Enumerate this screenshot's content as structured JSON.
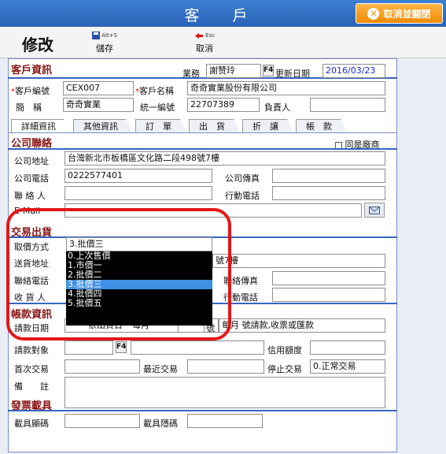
{
  "window": {
    "title": "客 戶",
    "cancel_close": "取消並關閉"
  },
  "toolbar": {
    "mode": "修改",
    "save": {
      "shortcut": "Alt+S",
      "label": "儲存"
    },
    "cancel": {
      "shortcut": "Esc",
      "label": "取消"
    }
  },
  "customer": {
    "section": "客戶資訊",
    "sales_label": "業務",
    "sales_value": "謝赞玲",
    "f4": "F4",
    "updated_label": "更新日期",
    "updated_value": "2016/03/23",
    "code_label": "客戶編號",
    "code_value": "CEX007",
    "name_label": "客戶名稱",
    "name_value": "奇奇實業股份有限公司",
    "abbr_label": "簡　稱",
    "abbr_value": "奇奇實業",
    "taxid_label": "統一編號",
    "taxid_value": "22707389",
    "owner_label": "負責人",
    "owner_value": ""
  },
  "tabs": [
    "詳細資訊",
    "其他資訊",
    "訂　單",
    "出　貨",
    "折　讓",
    "帳　款"
  ],
  "contact": {
    "section": "公司聯絡",
    "same_factory": "同是廠商",
    "address_label": "公司地址",
    "address_value": "台灣新北市板橋區文化路二段498號7樓",
    "phone_label": "公司電話",
    "phone_value": "0222577401",
    "fax_label": "公司傳真",
    "fax_value": "",
    "contact_label": "聯 絡 人",
    "contact_value": "",
    "mobile_label": "行動電話",
    "mobile_value": "",
    "email_label": "E-Mail"
  },
  "trade": {
    "section": "交易出貨",
    "price_label": "取價方式",
    "price_value": "3.批價三",
    "ship_addr_label": "送貨地址",
    "ship_addr_tail": "號7樓",
    "ship_phone_label": "聯絡電話",
    "ship_fax_label": "聯絡傳真",
    "receiver_label": "收 貨 人",
    "receiver_mobile_label": "行動電話",
    "price_options": [
      "0.上次售價",
      "1.市價一",
      "2.批價二",
      "3.批價三",
      "4.批價四",
      "5.批價五"
    ],
    "selected_index": 3
  },
  "billing": {
    "section": "帳款資訊",
    "date_label": "請款日期",
    "date_value": "依出貨日",
    "cycle_label": "每月",
    "closing_label": "號",
    "period_tail": "每月",
    "method_value": "號請款,收票或匯款",
    "target_label": "請款對象",
    "credit_label": "信用額度",
    "first_label": "首次交易",
    "last_label": "最近交易",
    "stop_label": "停止交易",
    "stop_value": "0.正常交易",
    "note_label": "備　　註"
  },
  "invoice": {
    "section": "發票載具",
    "visible_label": "載具顯碼",
    "hidden_label": "載具隱碼"
  }
}
